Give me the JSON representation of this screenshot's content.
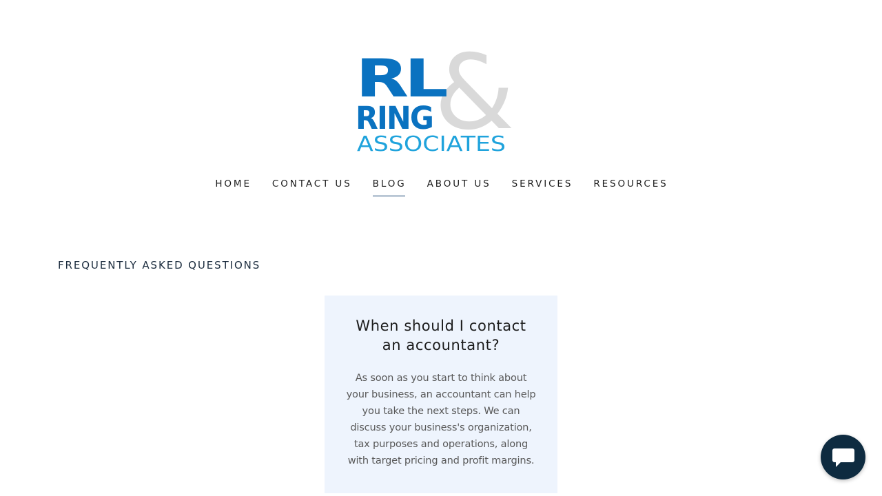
{
  "logo": {
    "line1": "RL",
    "ampersand": "&",
    "line2": "RING",
    "line3": "ASSOCIATES",
    "colors": {
      "primary_blue": "#0a72c0",
      "light_blue": "#1fa3dc",
      "gray": "#d9d9d9"
    }
  },
  "nav": {
    "items": [
      {
        "label": "HOME"
      },
      {
        "label": "CONTACT US"
      },
      {
        "label": "BLOG",
        "active": true
      },
      {
        "label": "ABOUT US"
      },
      {
        "label": "SERVICES"
      },
      {
        "label": "RESOURCES"
      }
    ]
  },
  "main": {
    "section_title": "FREQUENTLY ASKED QUESTIONS",
    "faq": {
      "question": "When should I contact an accountant?",
      "answer": "As soon as you start to think about your business, an accountant can help you take the next steps. We can discuss your business's organization, tax purposes and operations, along with target pricing and profit margins."
    }
  },
  "chat": {
    "icon": "chat-bubble-icon",
    "color": "#0e2b40"
  }
}
